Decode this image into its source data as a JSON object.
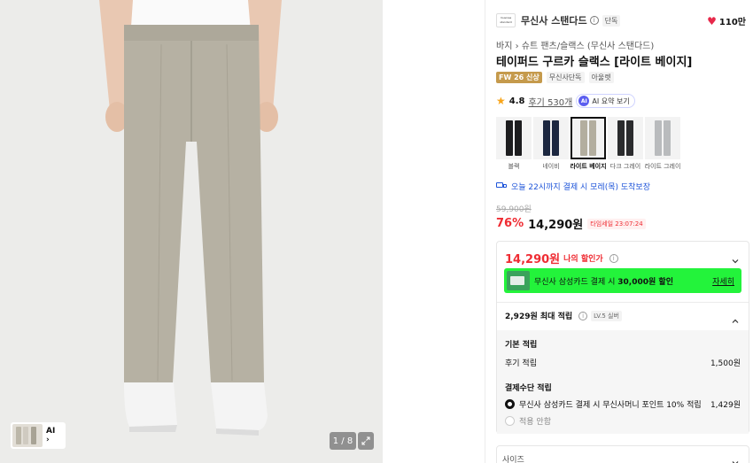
{
  "gallery": {
    "counter": "1 / 8",
    "thumb_ai_label": "AI",
    "thumb_chevron": "›",
    "expand_icon": "expand-icon"
  },
  "brand": {
    "logo_text": "musinsa standard",
    "name": "무신사 스탠다드",
    "info": "i",
    "exclusive_badge": "단독"
  },
  "likes": {
    "icon": "heart-icon",
    "count": "110만"
  },
  "breadcrumb": "바지 › 슈트 팬츠/슬랙스 (무신사 스탠다드)",
  "product": {
    "title": "테이퍼드 구르카 슬랙스 [라이트 베이지]",
    "tags": [
      "FW 26 신상",
      "무신사단독",
      "아울렛"
    ]
  },
  "rating": {
    "score": "4.8",
    "reviews": "후기 530개",
    "ai_badge": "AI",
    "ai_summary": "AI 요약 보기"
  },
  "colors": [
    {
      "name": "블랙",
      "tone": "#1d1d1f",
      "selected": false
    },
    {
      "name": "네이비",
      "tone": "#1c2740",
      "selected": false
    },
    {
      "name": "라이트 베이지",
      "tone": "#b3ae9f",
      "selected": true
    },
    {
      "name": "다크 그레이",
      "tone": "#2a2b2d",
      "selected": false
    },
    {
      "name": "라이트 그레이",
      "tone": "#b9bbbd",
      "selected": false
    }
  ],
  "delivery": "오늘 22시까지 결제 시 모레(목) 도착보장",
  "pricing": {
    "original": "59,900원",
    "discount": "76%",
    "price": "14,290원",
    "timesale": "타임세일 23:07:24"
  },
  "benefit": {
    "my_price": "14,290원",
    "my_price_label": "나의 할인가",
    "card_text_prefix": "무신사 삼성카드 결제 시",
    "card_text_bold": "30,000원 할인",
    "card_more": "자세히",
    "points_total": "2,929원 최대 적립",
    "level": "LV.5 실버",
    "base_title": "기본 적립",
    "review_label": "후기 적립",
    "review_amount": "1,500원",
    "payment_title": "결제수단 적립",
    "option1_label": "무신사 삼성카드 결제 시 무신사머니 포인트 10% 적립",
    "option1_amount": "1,429원",
    "option2_label": "적용 안함"
  },
  "size": {
    "label": "사이즈"
  },
  "theme": {
    "accent_red": "#ef2c33",
    "card_green": "#23f33b",
    "link_blue": "#1e54d9"
  }
}
